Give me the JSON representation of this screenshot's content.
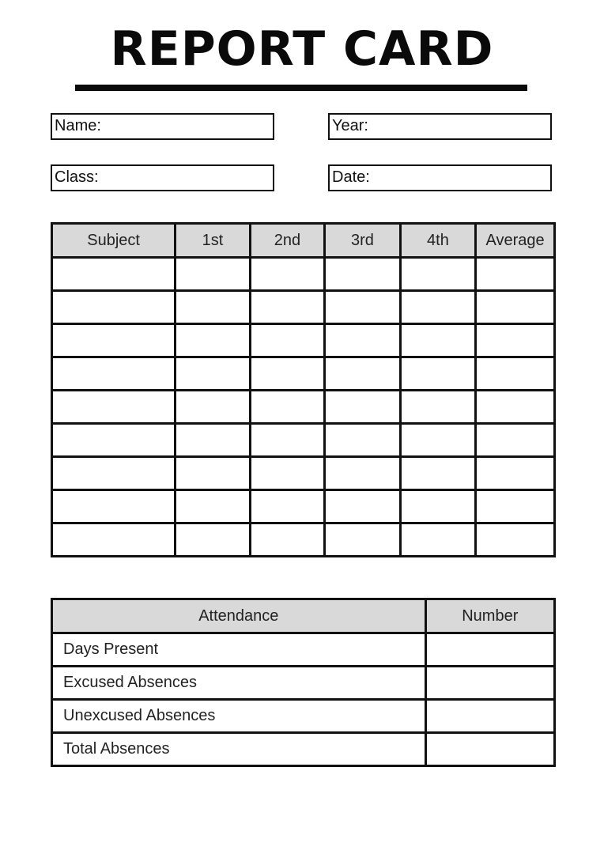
{
  "title": "REPORT CARD",
  "fields": {
    "name": "Name:",
    "year": "Year:",
    "class": "Class:",
    "date": "Date:"
  },
  "grades": {
    "headers": [
      "Subject",
      "1st",
      "2nd",
      "3rd",
      "4th",
      "Average"
    ],
    "row_count": 9
  },
  "attendance": {
    "headers": [
      "Attendance",
      "Number"
    ],
    "rows": [
      "Days Present",
      "Excused Absences",
      "Unexcused Absences",
      "Total Absences"
    ]
  }
}
